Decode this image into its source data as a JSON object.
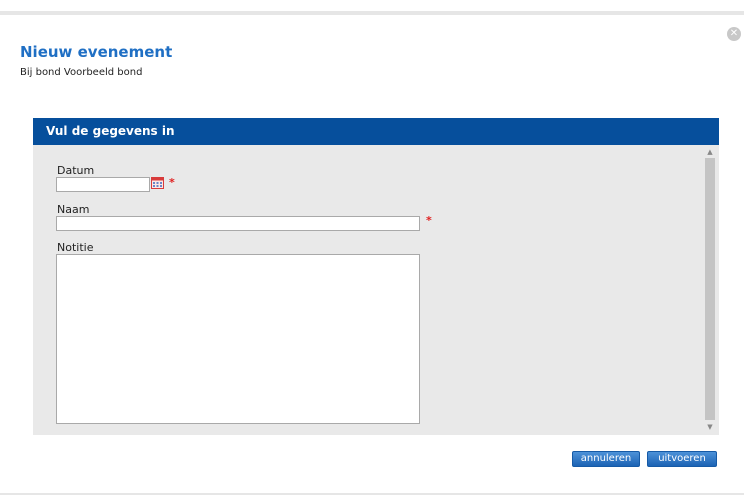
{
  "dialog": {
    "title": "Nieuw evenement",
    "subtitle": "Bij bond Voorbeeld bond",
    "close_icon": "close-icon"
  },
  "panel": {
    "header": "Vul de gegevens in"
  },
  "form": {
    "datum": {
      "label": "Datum",
      "value": "",
      "required_mark": "*",
      "icon": "calendar-icon"
    },
    "naam": {
      "label": "Naam",
      "value": "",
      "required_mark": "*"
    },
    "notitie": {
      "label": "Notitie",
      "value": ""
    }
  },
  "buttons": {
    "cancel": "annuleren",
    "submit": "uitvoeren"
  },
  "colors": {
    "title": "#1f6fc4",
    "header_bg": "#064f9c",
    "button": "#1c63b4",
    "required": "#e02020"
  }
}
